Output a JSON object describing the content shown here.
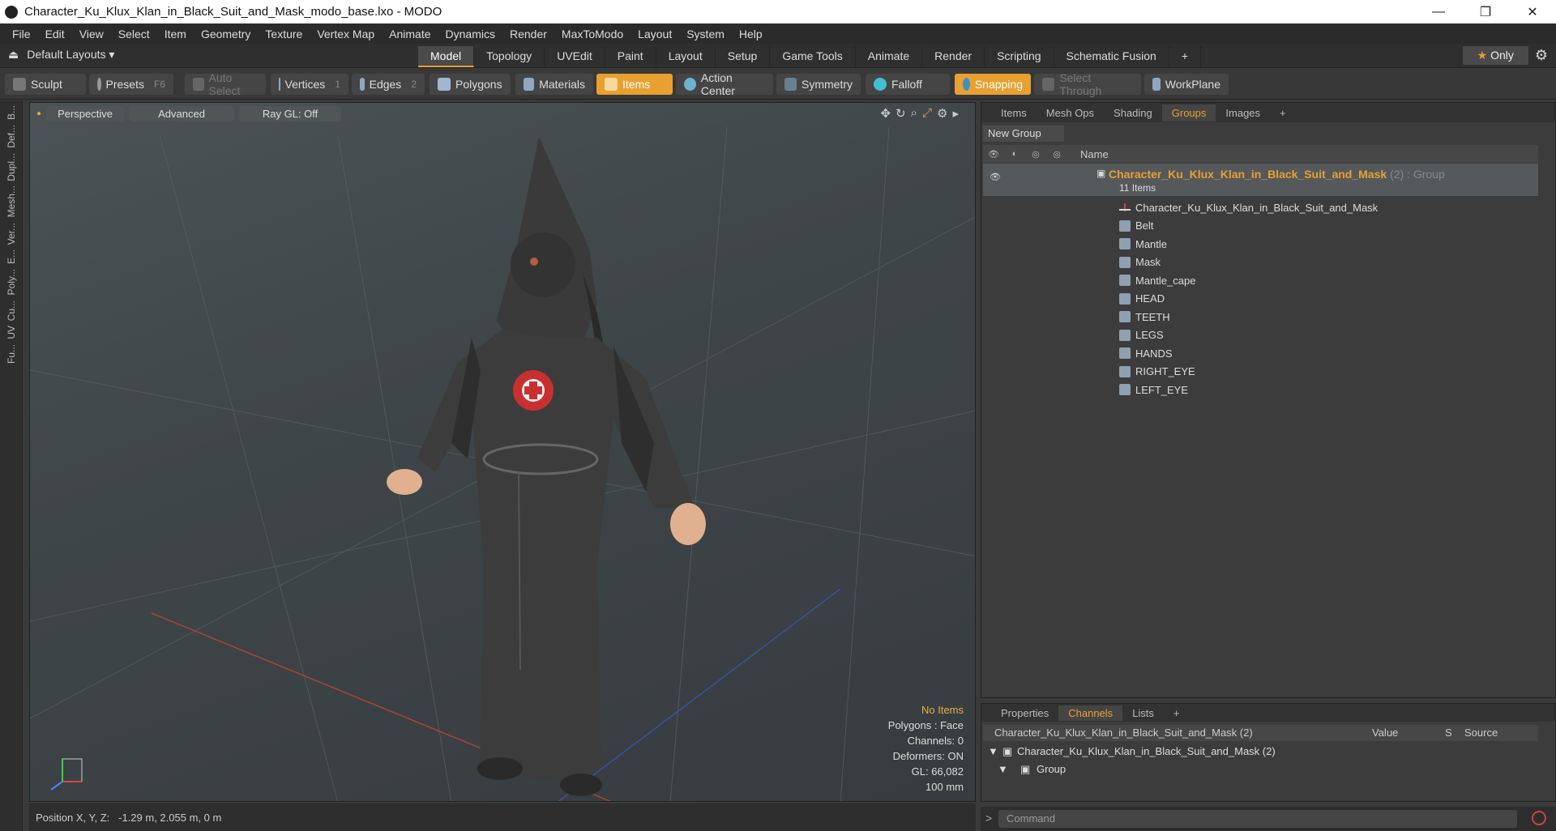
{
  "window": {
    "title": "Character_Ku_Klux_Klan_in_Black_Suit_and_Mask_modo_base.lxo - MODO",
    "controls": [
      "—",
      "❐",
      "✕"
    ]
  },
  "menubar": [
    "File",
    "Edit",
    "View",
    "Select",
    "Item",
    "Geometry",
    "Texture",
    "Vertex Map",
    "Animate",
    "Dynamics",
    "Render",
    "MaxToModo",
    "Layout",
    "System",
    "Help"
  ],
  "layout_selector": "Default Layouts ▾",
  "layout_tabs": [
    "Model",
    "Topology",
    "UVEdit",
    "Paint",
    "Layout",
    "Setup",
    "Game Tools",
    "Animate",
    "Render",
    "Scripting",
    "Schematic Fusion",
    "+"
  ],
  "only_label": "Only",
  "toolbar": {
    "sculpt": "Sculpt",
    "presets": "Presets",
    "presets_key": "F6",
    "auto_select": "Auto Select",
    "vertices": "Vertices",
    "vertices_key": "1",
    "edges": "Edges",
    "edges_key": "2",
    "polygons": "Polygons",
    "materials": "Materials",
    "items": "Items",
    "action_center": "Action Center",
    "symmetry": "Symmetry",
    "falloff": "Falloff",
    "snapping": "Snapping",
    "select_through": "Select Through",
    "workplane": "WorkPlane"
  },
  "left_strip": [
    "B...",
    "Def...",
    "Dupl...",
    "Mesh...",
    "Ver...",
    "E...",
    "Poly...",
    "Cu...",
    "UV",
    "Fu..."
  ],
  "viewport": {
    "perspective": "Perspective",
    "advanced": "Advanced",
    "raygl": "Ray GL: Off",
    "stats": {
      "no_items": "No Items",
      "polygons": "Polygons : Face",
      "channels": "Channels: 0",
      "deformers": "Deformers: ON",
      "gl": "GL: 66,082",
      "scale": "100 mm"
    }
  },
  "status": "Position X, Y, Z:   -1.29 m, 2.055 m, 0 m",
  "right_panel": {
    "tabs": [
      "Items",
      "Mesh Ops",
      "Shading",
      "Groups",
      "Images",
      "+"
    ],
    "new_group": "New Group",
    "name_col": "Name",
    "group_name": "Character_Ku_Klux_Klan_in_Black_Suit_and_Mask",
    "group_suffix": "(2) : Group",
    "group_count": "11 Items",
    "items": [
      "Character_Ku_Klux_Klan_in_Black_Suit_and_Mask",
      "Belt",
      "Mantle",
      "Mask",
      "Mantle_cape",
      "HEAD",
      "TEETH",
      "LEGS",
      "HANDS",
      "RIGHT_EYE",
      "LEFT_EYE"
    ]
  },
  "lower_panel": {
    "tabs": [
      "Properties",
      "Channels",
      "Lists",
      "+"
    ],
    "header": "Character_Ku_Klux_Klan_in_Black_Suit_and_Mask (2)",
    "value_col": "Value",
    "s_col": "S",
    "source_col": "Source",
    "row1": "Character_Ku_Klux_Klan_in_Black_Suit_and_Mask (2)",
    "row2": "Group"
  },
  "command_placeholder": "Command",
  "colors": {
    "accent": "#e8a030",
    "panel": "#3c3c3c"
  }
}
